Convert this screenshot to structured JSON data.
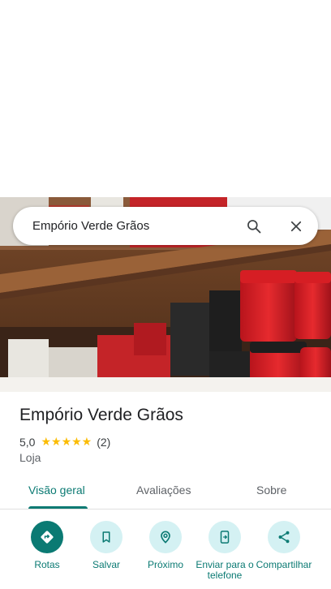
{
  "search": {
    "query": "Empório Verde Grãos"
  },
  "place": {
    "name": "Empório Verde Grãos",
    "rating": "5,0",
    "stars": "★★★★★",
    "review_count": "(2)",
    "category": "Loja"
  },
  "tabs": [
    {
      "label": "Visão geral",
      "active": true
    },
    {
      "label": "Avaliações",
      "active": false
    },
    {
      "label": "Sobre",
      "active": false
    }
  ],
  "actions": [
    {
      "label": "Rotas",
      "icon": "directions-icon"
    },
    {
      "label": "Salvar",
      "icon": "bookmark-icon"
    },
    {
      "label": "Próximo",
      "icon": "nearby-icon"
    },
    {
      "label": "Enviar para o telefone",
      "icon": "send-to-phone-icon"
    },
    {
      "label": "Compartilhar",
      "icon": "share-icon"
    }
  ],
  "colors": {
    "accent": "#0b7a73",
    "accent_light": "#d4f1f3",
    "star": "#fbbc04"
  }
}
